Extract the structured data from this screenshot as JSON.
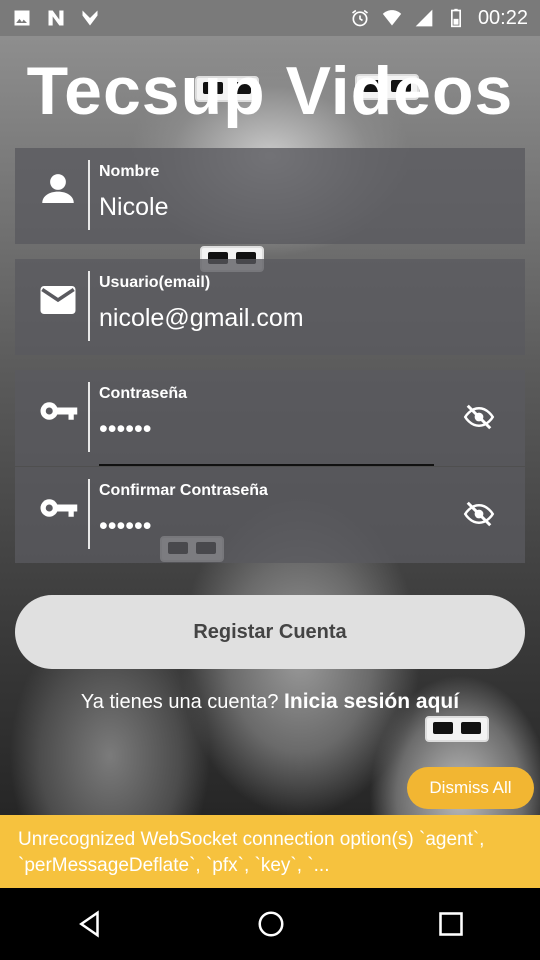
{
  "status_bar": {
    "time": "00:22",
    "icons": [
      "image-icon",
      "n-app-icon",
      "check-app-icon",
      "alarm-icon",
      "wifi-icon",
      "signal-icon",
      "battery-icon"
    ]
  },
  "app": {
    "title": "Tecsup Videos"
  },
  "form": {
    "name": {
      "label": "Nombre",
      "value": "Nicole",
      "icon": "person-icon"
    },
    "email": {
      "label": "Usuario(email)",
      "value": "nicole@gmail.com",
      "icon": "mail-icon"
    },
    "password": {
      "label": "Contraseña",
      "value": "••••••",
      "icon": "key-icon",
      "toggle_icon": "eye-off-icon"
    },
    "confirm_password": {
      "label": "Confirmar Contraseña",
      "value": "••••••",
      "icon": "key-icon",
      "toggle_icon": "eye-off-icon"
    }
  },
  "register_button": {
    "label": "Registar Cuenta"
  },
  "login_prompt": {
    "text": "Ya tienes una cuenta? ",
    "link": "Inicia sesión aquí"
  },
  "dismiss": {
    "label": "Dismiss All"
  },
  "warning": {
    "text": "Unrecognized WebSocket connection option(s) `agent`, `perMessageDeflate`, `pfx`, `key`, `..."
  },
  "colors": {
    "warning_bg": "#f6c23e",
    "dismiss_bg": "#f2b632",
    "field_bg": "#5a5a5f",
    "button_bg": "#e0e0e0"
  },
  "nav": {
    "icons": [
      "back-icon",
      "home-icon",
      "recents-icon"
    ]
  }
}
